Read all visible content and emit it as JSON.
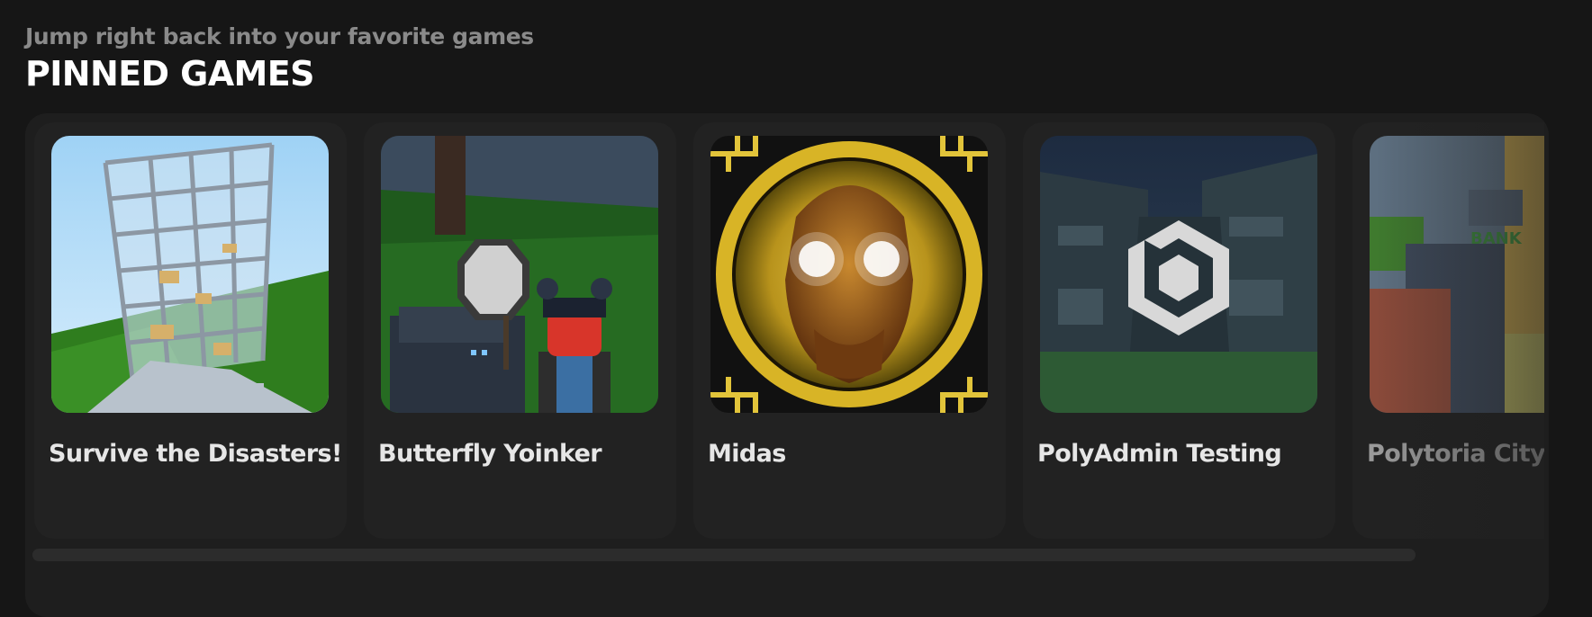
{
  "section": {
    "subtitle": "Jump right back into your favorite games",
    "title": "PINNED GAMES"
  },
  "games": [
    {
      "title": "Survive the Disasters!",
      "thumbnail": "collapsing-building-image"
    },
    {
      "title": "Butterfly Yoinker",
      "thumbnail": "character-with-net-image"
    },
    {
      "title": "Midas",
      "thumbnail": "golden-face-image"
    },
    {
      "title": "PolyAdmin Testing",
      "thumbnail": "polyadmin-logo-image"
    },
    {
      "title": "Polytoria City",
      "thumbnail": "city-street-image"
    }
  ],
  "colors": {
    "background": "#161616",
    "panel": "#1e1e1e",
    "card": "#222222",
    "subtitle_text": "#8a8a8a",
    "title_text": "#ffffff"
  }
}
